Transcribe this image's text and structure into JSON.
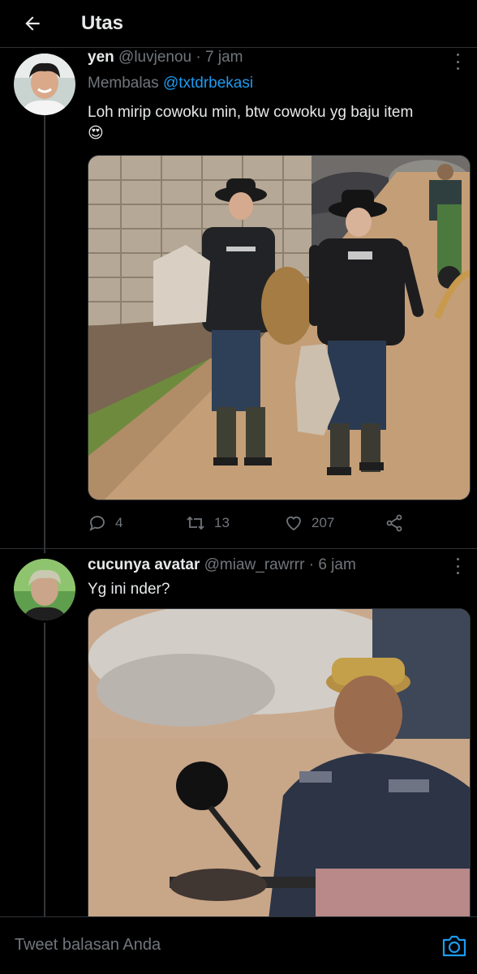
{
  "header": {
    "title": "Utas",
    "back_icon": "arrow-left-icon"
  },
  "tweets": [
    {
      "name": "yen",
      "handle": "@luvjenou",
      "time": "· 7 jam",
      "reply_prefix": "Membalas",
      "reply_mention": "@txtdrbekasi",
      "text": "Loh mirip cowoku min, btw cowoku yg baju item",
      "emoji": "😍",
      "media_alt": "two men in black shirts and hats carrying sacks on a dirt road",
      "stats": {
        "replies": "4",
        "retweets": "13",
        "likes": "207"
      }
    },
    {
      "name": "cucunya avatar",
      "handle": "@miaw_rawrrr",
      "time": "· 6 jam",
      "text": "Yg ini nder?",
      "media_alt": "blurry zoomed photo of a man in a cap riding a motorcycle"
    }
  ],
  "reply_bar": {
    "placeholder": "Tweet balasan Anda",
    "camera_icon": "camera-icon"
  },
  "colors": {
    "background": "#000000",
    "accent": "#1d9bf0",
    "muted": "#71767b",
    "text": "#e7e9ea"
  }
}
